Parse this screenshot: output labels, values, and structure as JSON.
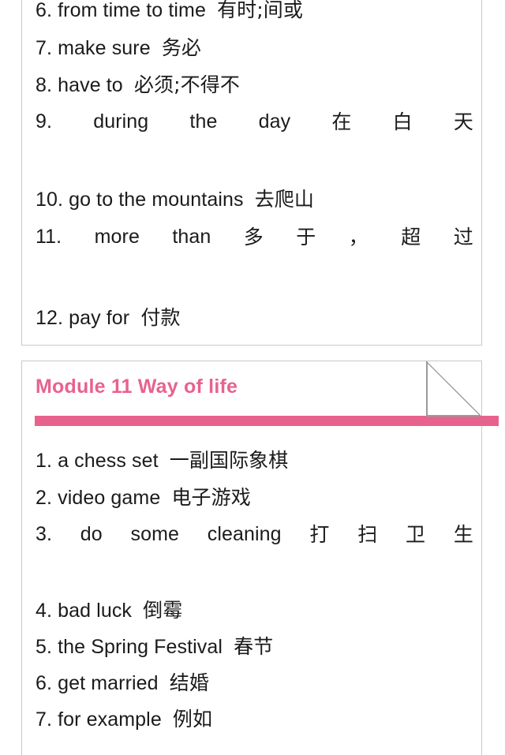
{
  "document": {
    "type": "vocabulary-notes-page",
    "background_color": "#ffffff",
    "text_color": "#1b1b1b",
    "accent_color": "#e8628e",
    "card_border_color": "#c9c9c9"
  },
  "card_top": {
    "name": "vocabulary-card-previous-module",
    "entries": [
      {
        "num": "6.",
        "en": "from time to time",
        "cn": "有时;间或",
        "justified": false
      },
      {
        "num": "7.",
        "en": "make sure",
        "cn": "务必",
        "justified": false
      },
      {
        "num": "8.",
        "en": "have to",
        "cn": "必须;不得不",
        "justified": false
      },
      {
        "num": "9.",
        "en": "during the day",
        "cn": "在白天",
        "justified": true,
        "parts": [
          "9.",
          "during",
          "the",
          "day",
          "在",
          "白",
          "天"
        ]
      },
      {
        "num": "10.",
        "en": "go to the mountains",
        "cn": "去爬山",
        "justified": false
      },
      {
        "num": "11.",
        "en": "more than",
        "cn": "多于，超过",
        "justified": true,
        "parts": [
          "11.",
          "more",
          "than",
          "多",
          "于",
          "，",
          "超",
          "过"
        ]
      },
      {
        "num": "12.",
        "en": "pay for",
        "cn": "付款",
        "justified": false
      }
    ]
  },
  "card_bottom": {
    "name": "vocabulary-card-module-11",
    "header": {
      "module_label": "Module 11",
      "module_name": "Way of life",
      "full_title": "Module 11  Way of life",
      "color": "#e8628e"
    },
    "entries": [
      {
        "num": "1.",
        "en": "a chess set",
        "cn": "一副国际象棋",
        "justified": false
      },
      {
        "num": "2.",
        "en": "video game",
        "cn": "电子游戏",
        "justified": false
      },
      {
        "num": "3.",
        "en": "do some cleaning",
        "cn": "打扫卫生",
        "justified": true,
        "parts": [
          "3.",
          "do",
          "some",
          "cleaning",
          "打",
          "扫",
          "卫",
          "生"
        ]
      },
      {
        "num": "4.",
        "en": "bad luck",
        "cn": "倒霉",
        "justified": false
      },
      {
        "num": "5.",
        "en": "the Spring Festival",
        "cn": "春节",
        "justified": false
      },
      {
        "num": "6.",
        "en": "get married",
        "cn": "结婚",
        "justified": false
      },
      {
        "num": "7.",
        "en": "for example",
        "cn": "例如",
        "justified": false
      }
    ]
  },
  "lines": {
    "t6": {
      "num": "6.",
      "en": "from time to time",
      "cn": "有时;间或"
    },
    "t7": {
      "num": "7.",
      "en": "make sure",
      "cn": "务必"
    },
    "t8": {
      "num": "8.",
      "en": "have to",
      "cn": "必须;不得不"
    },
    "t9": {
      "p0": "9.",
      "p1": "during",
      "p2": "the",
      "p3": "day",
      "p4": "在",
      "p5": "白",
      "p6": "天"
    },
    "t10": {
      "num": "10.",
      "en": "go to the mountains",
      "cn": "去爬山"
    },
    "t11": {
      "p0": "11.",
      "p1": "more",
      "p2": "than",
      "p3": "多",
      "p4": "于",
      "p5": "，",
      "p6": "超",
      "p7": "过"
    },
    "t12": {
      "num": "12.",
      "en": "pay for",
      "cn": "付款"
    },
    "b1": {
      "num": "1.",
      "en": "a chess set",
      "cn": "一副国际象棋"
    },
    "b2": {
      "num": "2.",
      "en": "video game",
      "cn": "电子游戏"
    },
    "b3": {
      "p0": "3.",
      "p1": "do",
      "p2": "some",
      "p3": "cleaning",
      "p4": "打",
      "p5": "扫",
      "p6": "卫",
      "p7": "生"
    },
    "b4": {
      "num": "4.",
      "en": "bad luck",
      "cn": "倒霉"
    },
    "b5": {
      "num": "5.",
      "en": "the Spring Festival",
      "cn": "春节"
    },
    "b6": {
      "num": "6.",
      "en": "get married",
      "cn": "结婚"
    },
    "b7": {
      "num": "7.",
      "en": "for example",
      "cn": "例如"
    }
  },
  "decoration": {
    "folded_corner": "page-fold-triangle",
    "pink_rule": "header-underline-bar"
  }
}
